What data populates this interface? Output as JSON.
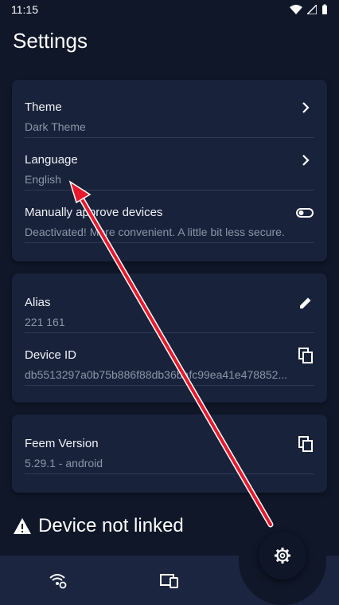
{
  "status": {
    "time": "11:15"
  },
  "page": {
    "title": "Settings"
  },
  "settings": {
    "theme": {
      "label": "Theme",
      "value": "Dark Theme"
    },
    "language": {
      "label": "Language",
      "value": "English"
    },
    "approve": {
      "label": "Manually approve devices",
      "value": "Deactivated! More convenient. A little bit less secure."
    }
  },
  "device": {
    "alias": {
      "label": "Alias",
      "value": "221 161"
    },
    "device_id": {
      "label": "Device ID",
      "value": "db5513297a0b75b886f88db36bafc99ea41e478852..."
    }
  },
  "version": {
    "label": "Feem Version",
    "value": "5.29.1 - android"
  },
  "alert": {
    "text": "Device not linked"
  },
  "icons": {
    "chevron": "chevron-right-icon",
    "toggle": "toggle-off-icon",
    "edit": "pencil-icon",
    "copy": "copy-icon",
    "warning": "warning-icon",
    "wifi": "wifi-settings-icon",
    "devices": "devices-icon",
    "gear": "gear-icon"
  },
  "colors": {
    "background": "#0f1729",
    "card": "#18223a",
    "annotation_arrow": "#e8192c"
  }
}
